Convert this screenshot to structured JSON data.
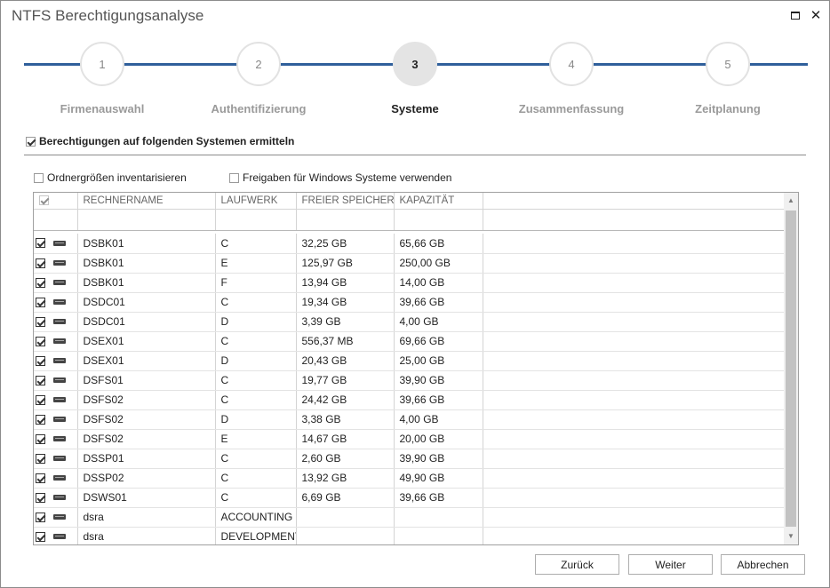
{
  "window": {
    "title": "NTFS Berechtigungsanalyse"
  },
  "steps": [
    {
      "number": "1",
      "label": "Firmenauswahl",
      "active": false
    },
    {
      "number": "2",
      "label": "Authentifizierung",
      "active": false
    },
    {
      "number": "3",
      "label": "Systeme",
      "active": true
    },
    {
      "number": "4",
      "label": "Zusammenfassung",
      "active": false
    },
    {
      "number": "5",
      "label": "Zeitplanung",
      "active": false
    }
  ],
  "options": {
    "main_label": "Berechtigungen auf folgenden Systemen ermitteln",
    "main_checked": true,
    "folder_sizes_label": "Ordnergrößen inventarisieren",
    "folder_sizes_checked": false,
    "shares_label": "Freigaben für Windows Systeme verwenden",
    "shares_checked": false
  },
  "grid": {
    "columns": [
      "RECHNERNAME",
      "LAUFWERK",
      "FREIER SPEICHER",
      "KAPAZITÄT"
    ],
    "rows": [
      {
        "name": "DSBK01",
        "drive": "C",
        "free": "32,25 GB",
        "capacity": "65,66 GB",
        "checked": true
      },
      {
        "name": "DSBK01",
        "drive": "E",
        "free": "125,97 GB",
        "capacity": "250,00 GB",
        "checked": true
      },
      {
        "name": "DSBK01",
        "drive": "F",
        "free": "13,94 GB",
        "capacity": "14,00 GB",
        "checked": true
      },
      {
        "name": "DSDC01",
        "drive": "C",
        "free": "19,34 GB",
        "capacity": "39,66 GB",
        "checked": true
      },
      {
        "name": "DSDC01",
        "drive": "D",
        "free": "3,39 GB",
        "capacity": "4,00 GB",
        "checked": true
      },
      {
        "name": "DSEX01",
        "drive": "C",
        "free": "556,37 MB",
        "capacity": "69,66 GB",
        "checked": true
      },
      {
        "name": "DSEX01",
        "drive": "D",
        "free": "20,43 GB",
        "capacity": "25,00 GB",
        "checked": true
      },
      {
        "name": "DSFS01",
        "drive": "C",
        "free": "19,77 GB",
        "capacity": "39,90 GB",
        "checked": true
      },
      {
        "name": "DSFS02",
        "drive": "C",
        "free": "24,42 GB",
        "capacity": "39,66 GB",
        "checked": true
      },
      {
        "name": "DSFS02",
        "drive": "D",
        "free": "3,38 GB",
        "capacity": "4,00 GB",
        "checked": true
      },
      {
        "name": "DSFS02",
        "drive": "E",
        "free": "14,67 GB",
        "capacity": "20,00 GB",
        "checked": true
      },
      {
        "name": "DSSP01",
        "drive": "C",
        "free": "2,60 GB",
        "capacity": "39,90 GB",
        "checked": true
      },
      {
        "name": "DSSP02",
        "drive": "C",
        "free": "13,92 GB",
        "capacity": "49,90 GB",
        "checked": true
      },
      {
        "name": "DSWS01",
        "drive": "C",
        "free": "6,69 GB",
        "capacity": "39,66 GB",
        "checked": true
      },
      {
        "name": "dsra",
        "drive": "ACCOUNTING",
        "free": "",
        "capacity": "",
        "checked": true
      },
      {
        "name": "dsra",
        "drive": "DEVELOPMENT",
        "free": "",
        "capacity": "",
        "checked": true
      }
    ]
  },
  "buttons": {
    "back": "Zurück",
    "next": "Weiter",
    "cancel": "Abbrechen"
  },
  "icons": {
    "row_icon": "server-icon",
    "maximize": "maximize-icon",
    "close": "close-icon"
  }
}
